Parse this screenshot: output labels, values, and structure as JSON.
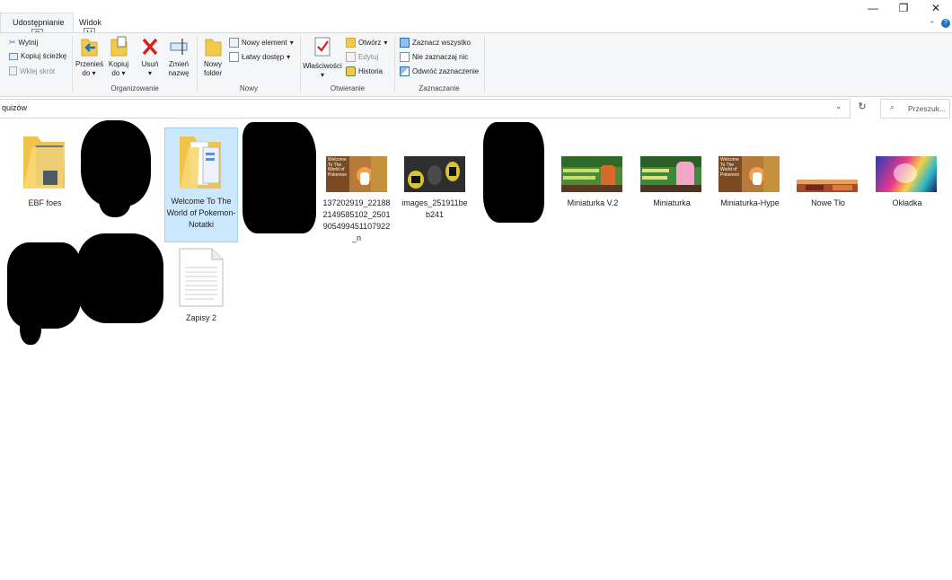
{
  "tabs": {
    "share": "Udostępnianie",
    "share_keytip": "S",
    "view": "Widok",
    "view_keytip": "V"
  },
  "window": {
    "minimize": "—",
    "maximize": "❐",
    "close": "✕"
  },
  "ribbon": {
    "clipboard": {
      "cut": "Wytnij",
      "copy_path": "Kopiuj ścieżkę",
      "paste_shortcut": "Wklej skrót"
    },
    "organize": {
      "label": "Organizowanie",
      "move_l1": "Przenieś",
      "move_l2": "do",
      "copy_l1": "Kopiuj",
      "copy_l2": "do",
      "delete_l1": "Usuń",
      "rename_l1": "Zmień",
      "rename_l2": "nazwę"
    },
    "new": {
      "label": "Nowy",
      "new_folder_l1": "Nowy",
      "new_folder_l2": "folder",
      "new_item": "Nowy element",
      "easy_access": "Łatwy dostęp"
    },
    "open": {
      "label": "Otwieranie",
      "properties": "Właściwości",
      "open": "Otwórz",
      "edit": "Edytuj",
      "history": "Historia"
    },
    "select": {
      "label": "Zaznaczanie",
      "select_all": "Zaznacz wszystko",
      "select_none": "Nie zaznaczaj nic",
      "invert": "Odwróć zaznaczenie"
    }
  },
  "address": {
    "path": "quizów",
    "search_placeholder": "Przeszuk..."
  },
  "files": [
    {
      "name": "EBF foes"
    },
    {
      "name": "Welcome To The World of Pokemon-Notatki"
    },
    {
      "name": "137202919_221882149585102_2501905499451107922_n"
    },
    {
      "name": "images_251911beb241"
    },
    {
      "name": "Miniaturka V.2"
    },
    {
      "name": "Miniaturka"
    },
    {
      "name": "Miniaturka-Hype"
    },
    {
      "name": "Nowe Tło"
    },
    {
      "name": "Okładka"
    },
    {
      "name": "Zapisy 2"
    }
  ],
  "thumb_text": {
    "welcome": "Welcome To The World of Pokemon"
  },
  "colors": {
    "selection": "#cce8ff",
    "folder": "#f7d774",
    "ribbon_bg": "#f5f6f7",
    "accent": "#1a73c8"
  }
}
